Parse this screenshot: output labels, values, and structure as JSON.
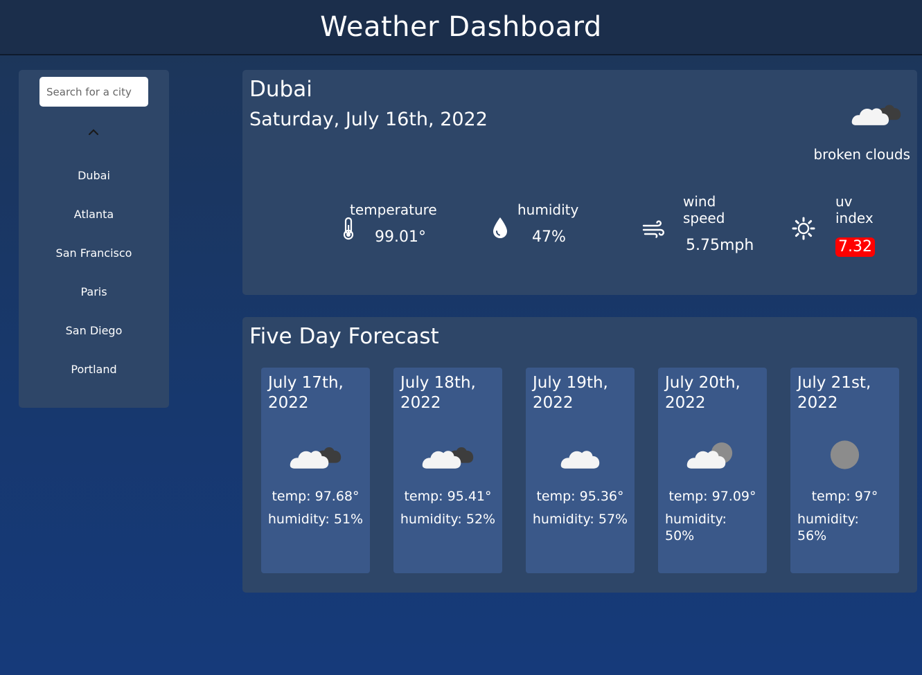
{
  "header": {
    "title": "Weather Dashboard"
  },
  "sidebar": {
    "search_placeholder": "Search for a city",
    "cities": [
      "Dubai",
      "Atlanta",
      "San Francisco",
      "Paris",
      "San Diego",
      "Portland"
    ]
  },
  "current": {
    "city": "Dubai",
    "date": "Saturday, July 16th, 2022",
    "condition": "broken clouds",
    "condition_icon": "broken-clouds-icon",
    "temperature_label": "temperature",
    "temperature": "99.01°",
    "humidity_label": "humidity",
    "humidity": "47%",
    "wind_label_1": "wind",
    "wind_label_2": "speed",
    "wind": "5.75mph",
    "uv_label_1": "uv",
    "uv_label_2": "index",
    "uv": "7.32",
    "uv_color": "#ff0000"
  },
  "forecast": {
    "title": "Five Day Forecast",
    "days": [
      {
        "date_1": "July 17th,",
        "date_2": "2022",
        "temp": "temp: 97.68°",
        "hum_1": "humidity: 51%",
        "hum_2": "",
        "icon": "broken-clouds-icon"
      },
      {
        "date_1": "July 18th,",
        "date_2": "2022",
        "temp": "temp: 95.41°",
        "hum_1": "humidity: 52%",
        "hum_2": "",
        "icon": "broken-clouds-icon"
      },
      {
        "date_1": "July 19th,",
        "date_2": "2022",
        "temp": "temp: 95.36°",
        "hum_1": "humidity: 57%",
        "hum_2": "",
        "icon": "cloud-icon"
      },
      {
        "date_1": "July 20th,",
        "date_2": "2022",
        "temp": "temp: 97.09°",
        "hum_1": "humidity:",
        "hum_2": "50%",
        "icon": "partly-cloudy-icon"
      },
      {
        "date_1": "July 21st,",
        "date_2": "2022",
        "temp": "temp: 97°",
        "hum_1": "humidity:",
        "hum_2": "56%",
        "icon": "gray-circle-icon"
      }
    ]
  }
}
